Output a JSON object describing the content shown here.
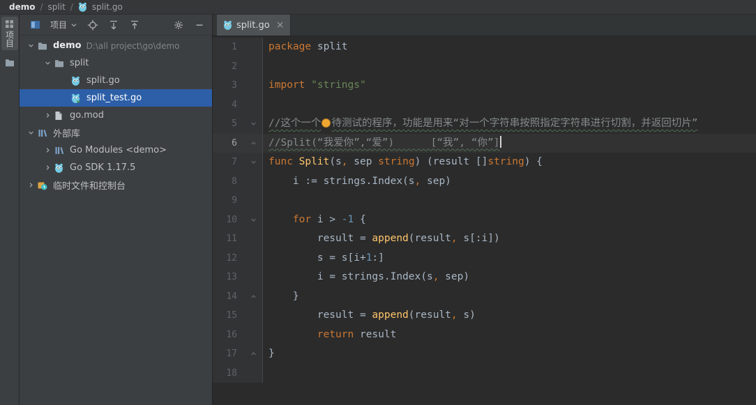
{
  "colors": {
    "editor_bg": "#2b2b2b",
    "panel_bg": "#3c3f41",
    "selection_blue": "#2d5fa8",
    "keyword_orange": "#cc7832",
    "string_green": "#6a8759",
    "number_blue": "#6897bb",
    "function_yellow": "#ffc66b",
    "comment_gray": "#848a8c"
  },
  "breadcrumb": {
    "project": "demo",
    "separator": "/",
    "folder": "split",
    "file": "split.go"
  },
  "tool_strip": {
    "project_label": "项目"
  },
  "project_panel": {
    "title": "项目",
    "tree": [
      {
        "id": "demo",
        "level": 0,
        "chevron": "down",
        "icon": "folder",
        "label": "demo",
        "sublabel": "D:\\all project\\go\\demo",
        "bold": true
      },
      {
        "id": "split",
        "level": 1,
        "chevron": "down",
        "icon": "folder",
        "label": "split"
      },
      {
        "id": "split-go",
        "level": 2,
        "chevron": "none",
        "icon": "gofile",
        "label": "split.go"
      },
      {
        "id": "split-test-go",
        "level": 2,
        "chevron": "none",
        "icon": "gotest",
        "label": "split_test.go",
        "selected": true
      },
      {
        "id": "go-mod",
        "level": 1,
        "chevron": "right",
        "icon": "file",
        "label": "go.mod"
      },
      {
        "id": "external-libraries",
        "level": 0,
        "chevron": "down",
        "icon": "lib",
        "label": "外部库"
      },
      {
        "id": "go-modules",
        "level": 1,
        "chevron": "right",
        "icon": "lib",
        "label": "Go Modules <demo>"
      },
      {
        "id": "go-sdk",
        "level": 1,
        "chevron": "right",
        "icon": "gopher",
        "label": "Go SDK 1.17.5"
      },
      {
        "id": "scratches-consoles",
        "level": 0,
        "chevron": "right",
        "icon": "scratch",
        "label": "临时文件和控制台"
      }
    ]
  },
  "editor": {
    "tab": "split.go",
    "tab_close": "×",
    "lines": [
      {
        "n": 1,
        "t": [
          [
            "kw",
            "package"
          ],
          [
            "pl",
            " split"
          ]
        ]
      },
      {
        "n": 2,
        "t": []
      },
      {
        "n": 3,
        "t": [
          [
            "kw",
            "import"
          ],
          [
            "pl",
            " "
          ],
          [
            "str",
            "\"strings\""
          ]
        ]
      },
      {
        "n": 4,
        "t": []
      },
      {
        "n": 5,
        "fold": "s",
        "t": [
          [
            "cmtw",
            "//这个一个"
          ],
          [
            "bulb",
            ""
          ],
          [
            "cmtw",
            "待测试的程序，功能是用来“对一个字符串按照指定字符串进行切割，并返回切片”"
          ]
        ]
      },
      {
        "n": 6,
        "fold": "e",
        "cur": true,
        "t": [
          [
            "cmtw",
            "//Split(“我爱你”,“爱”)      [“我”, “你”]"
          ],
          [
            "caret",
            ""
          ]
        ]
      },
      {
        "n": 7,
        "fold": "s",
        "t": [
          [
            "kw",
            "func "
          ],
          [
            "fn",
            "Split"
          ],
          [
            "pl",
            "(s"
          ],
          [
            "kw",
            ","
          ],
          [
            "pl",
            " sep "
          ],
          [
            "kw",
            "string"
          ],
          [
            "pl",
            ") (result []"
          ],
          [
            "kw",
            "string"
          ],
          [
            "pl",
            ") {"
          ]
        ]
      },
      {
        "n": 8,
        "t": [
          [
            "pl",
            "    i := strings.Index(s"
          ],
          [
            "kw",
            ","
          ],
          [
            "pl",
            " sep)"
          ]
        ]
      },
      {
        "n": 9,
        "t": []
      },
      {
        "n": 10,
        "fold": "s",
        "t": [
          [
            "pl",
            "    "
          ],
          [
            "kw",
            "for"
          ],
          [
            "pl",
            " i > "
          ],
          [
            "num",
            "-1"
          ],
          [
            "pl",
            " {"
          ]
        ]
      },
      {
        "n": 11,
        "t": [
          [
            "pl",
            "        result = "
          ],
          [
            "fn",
            "append"
          ],
          [
            "pl",
            "(result"
          ],
          [
            "kw",
            ","
          ],
          [
            "pl",
            " s[:i])"
          ]
        ]
      },
      {
        "n": 12,
        "t": [
          [
            "pl",
            "        s = s[i+"
          ],
          [
            "num",
            "1"
          ],
          [
            "pl",
            ":]"
          ]
        ]
      },
      {
        "n": 13,
        "t": [
          [
            "pl",
            "        i = strings.Index(s"
          ],
          [
            "kw",
            ","
          ],
          [
            "pl",
            " sep)"
          ]
        ]
      },
      {
        "n": 14,
        "fold": "e",
        "t": [
          [
            "pl",
            "    }"
          ]
        ]
      },
      {
        "n": 15,
        "t": [
          [
            "pl",
            "        result = "
          ],
          [
            "fn",
            "append"
          ],
          [
            "pl",
            "(result"
          ],
          [
            "kw",
            ","
          ],
          [
            "pl",
            " s)"
          ]
        ]
      },
      {
        "n": 16,
        "t": [
          [
            "pl",
            "        "
          ],
          [
            "kw",
            "return"
          ],
          [
            "pl",
            " result"
          ]
        ]
      },
      {
        "n": 17,
        "fold": "e",
        "t": [
          [
            "pl",
            "}"
          ]
        ]
      },
      {
        "n": 18,
        "t": []
      }
    ]
  }
}
